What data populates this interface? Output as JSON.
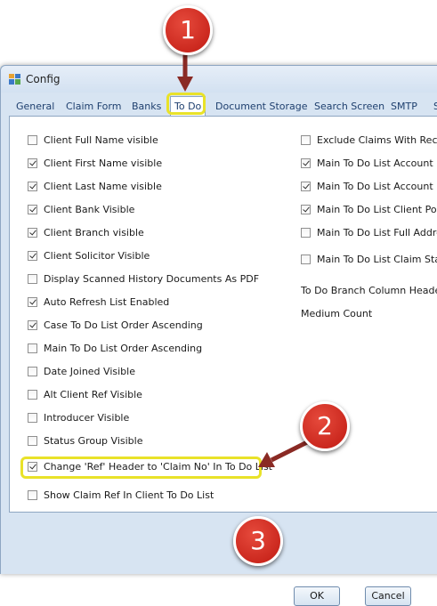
{
  "window": {
    "title": "Config"
  },
  "tabs": [
    "General",
    "Claim Form",
    "Banks",
    "To Do",
    "Document Storage",
    "Search Screen",
    "SMTP",
    "S"
  ],
  "active_tab": "To Do",
  "left_options": [
    {
      "label": "Client Full Name visible",
      "checked": false
    },
    {
      "label": "Client First Name visible",
      "checked": true
    },
    {
      "label": "Client Last Name visible",
      "checked": true
    },
    {
      "label": "Client Bank Visible",
      "checked": true
    },
    {
      "label": "Client Branch visible",
      "checked": true
    },
    {
      "label": "Client Solicitor Visible",
      "checked": true
    },
    {
      "label": "Display Scanned History Documents As PDF",
      "checked": false
    },
    {
      "label": "Auto Refresh List Enabled",
      "checked": true
    },
    {
      "label": "Case To Do List Order Ascending",
      "checked": true
    },
    {
      "label": "Main To Do List Order Ascending",
      "checked": false
    },
    {
      "label": "Date Joined Visible",
      "checked": false
    },
    {
      "label": "Alt Client Ref Visible",
      "checked": false
    },
    {
      "label": "Introducer Visible",
      "checked": false
    },
    {
      "label": "Status Group  Visible",
      "checked": false
    },
    {
      "label": "Change 'Ref' Header to 'Claim No' In To Do List",
      "checked": true
    },
    {
      "label": "Show Claim Ref In Client To Do List",
      "checked": false
    }
  ],
  "right_options": [
    {
      "label": "Exclude Claims With Recent",
      "checked": false
    },
    {
      "label": "Main To Do List Account Na",
      "checked": true
    },
    {
      "label": "Main To Do List Account Nu",
      "checked": true
    },
    {
      "label": "Main To Do List Client Posto",
      "checked": true
    },
    {
      "label": "Main To Do List Full Addres",
      "checked": false
    },
    {
      "label": "Main To Do List Claim Stage",
      "checked": false
    }
  ],
  "right_text": {
    "branch_header_label": "To Do Branch Column Header:",
    "branch_header_value": "Medium Count"
  },
  "buttons": {
    "ok": "OK",
    "cancel": "Cancel"
  },
  "callouts": [
    "1",
    "2",
    "3"
  ],
  "colors": {
    "highlight": "#e9e229",
    "callout": "#d22a1e",
    "arrow": "#8a2a24"
  }
}
